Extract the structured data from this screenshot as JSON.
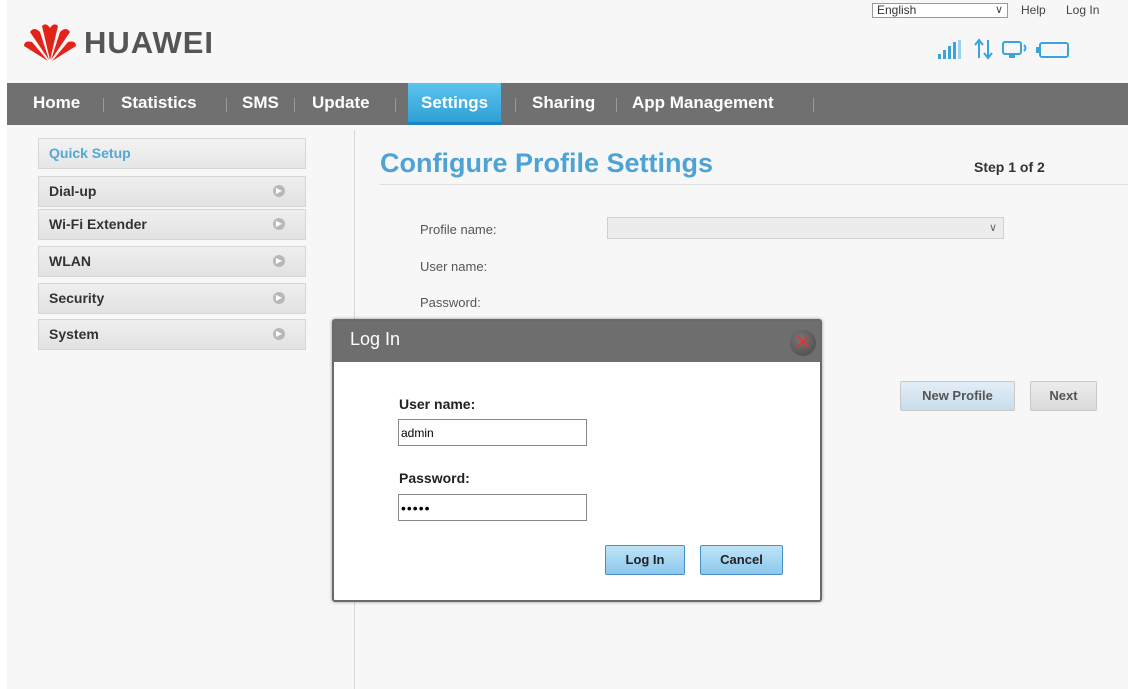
{
  "header": {
    "brand": "HUAWEI",
    "language": "English",
    "help_link": "Help",
    "login_link": "Log In",
    "status_icons": [
      "signal-icon",
      "data-transfer-icon",
      "wifi-device-icon",
      "battery-icon"
    ]
  },
  "nav": {
    "items": [
      {
        "label": "Home"
      },
      {
        "label": "Statistics"
      },
      {
        "label": "SMS"
      },
      {
        "label": "Update"
      },
      {
        "label": "Settings"
      },
      {
        "label": "Sharing"
      },
      {
        "label": "App Management"
      }
    ],
    "active": "Settings"
  },
  "sidebar": {
    "items": [
      {
        "label": "Quick Setup"
      },
      {
        "label": "Dial-up"
      },
      {
        "label": "Wi-Fi Extender"
      },
      {
        "label": "WLAN"
      },
      {
        "label": "Security"
      },
      {
        "label": "System"
      }
    ],
    "active": "Quick Setup"
  },
  "main": {
    "title": "Configure Profile Settings",
    "step": "Step 1 of 2",
    "form": {
      "profile_name_label": "Profile name:",
      "user_name_label": "User name:",
      "password_label": "Password:"
    },
    "new_profile_button": "New Profile",
    "next_button": "Next"
  },
  "dialog": {
    "title": "Log In",
    "username_label": "User name:",
    "username_value": "admin",
    "password_label": "Password:",
    "password_value": "•••••",
    "login_button": "Log In",
    "cancel_button": "Cancel"
  },
  "colors": {
    "accent_blue": "#4da3d4",
    "nav_bg": "#707070",
    "brand_red": "#e2231a"
  }
}
